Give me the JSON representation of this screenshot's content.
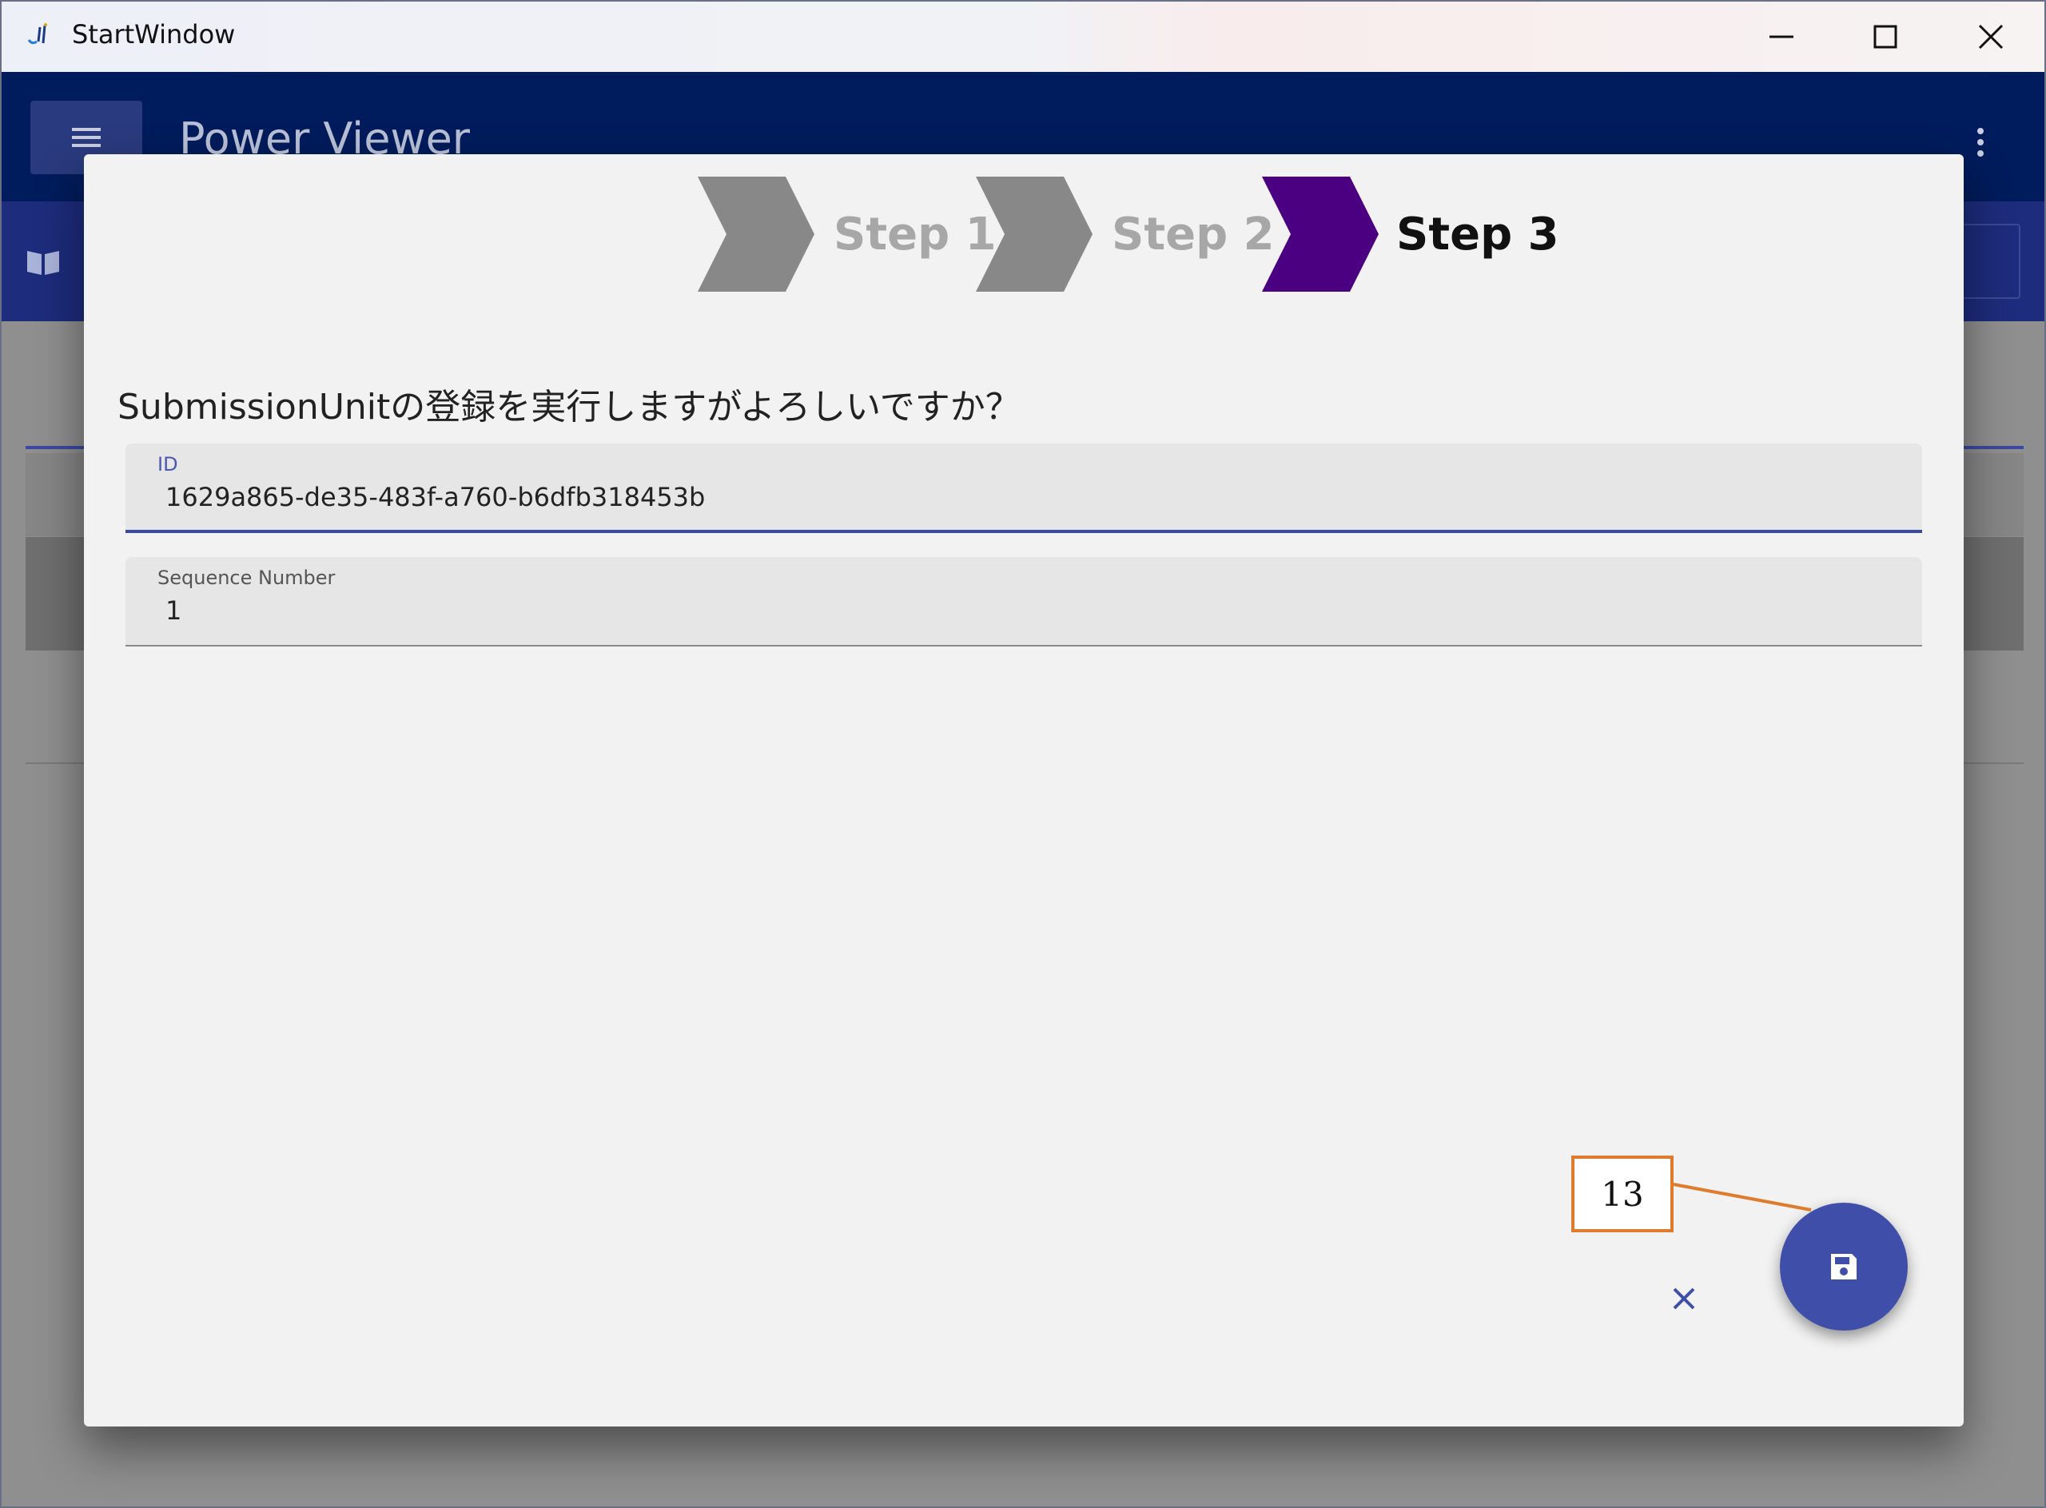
{
  "window": {
    "title": "StartWindow",
    "app_icon": "wpf-app-icon"
  },
  "appbar": {
    "title": "Power Viewer",
    "menu_icon": "hamburger-icon",
    "more_icon": "kebab-icon",
    "color": "#001c5c"
  },
  "dialog": {
    "steps": [
      {
        "label": "Step 1",
        "state": "inactive"
      },
      {
        "label": "Step 2",
        "state": "inactive"
      },
      {
        "label": "Step 3",
        "state": "active"
      }
    ],
    "question": "SubmissionUnitの登録を実行しますがよろしいですか？",
    "fields": {
      "id": {
        "label": "ID",
        "value": "1629a865-de35-483f-a760-b6dfb318453b"
      },
      "sequence": {
        "label": "Sequence Number",
        "value": "1"
      }
    },
    "cancel_icon": "close-icon",
    "save_icon": "save-icon",
    "active_step_color": "#4b0082",
    "inactive_step_color": "#888888",
    "accent": "#3f4fa9"
  },
  "annotation": {
    "callout_number": "13",
    "color": "#e07a2c"
  }
}
